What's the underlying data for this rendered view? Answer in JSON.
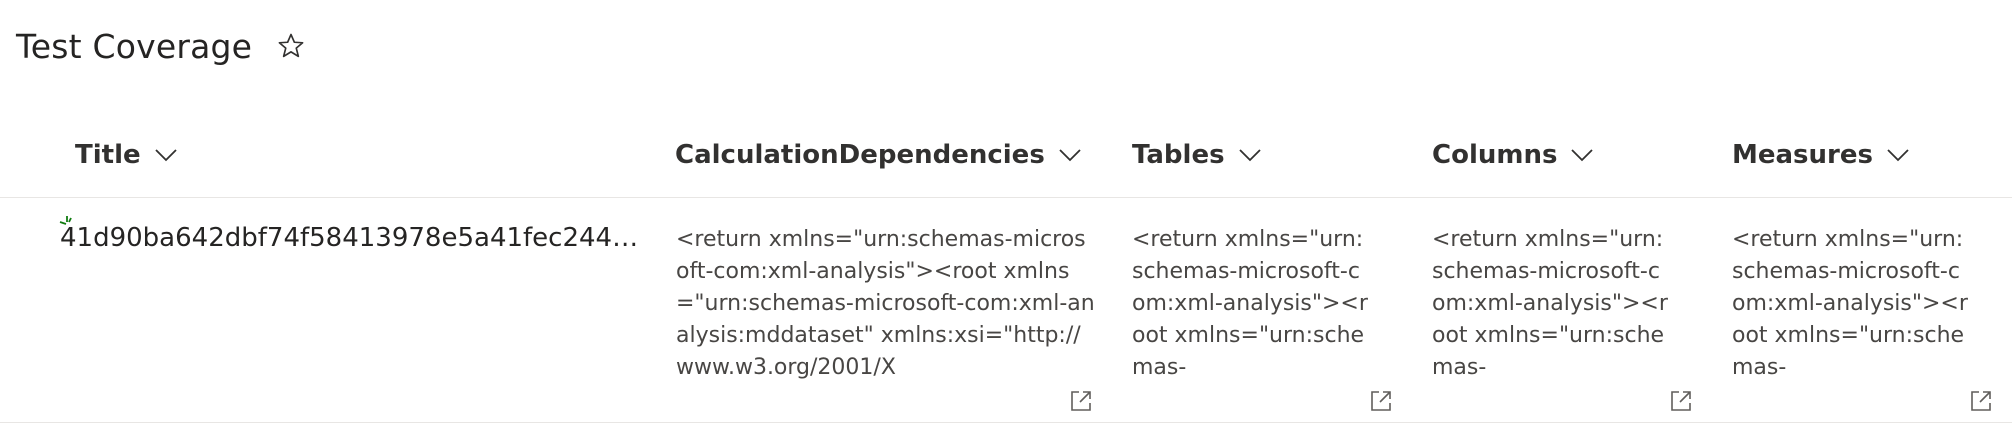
{
  "page": {
    "title": "Test Coverage"
  },
  "columns": [
    {
      "label": "Title"
    },
    {
      "label": "CalculationDependencies"
    },
    {
      "label": "Tables"
    },
    {
      "label": "Columns"
    },
    {
      "label": "Measures"
    }
  ],
  "row": {
    "title": "41d90ba642dbf74f58413978e5a41fec244ca…",
    "calculation_dependencies": "<return xmlns=\"urn:schemas-microsoft-com:xml-analysis\"><root xmlns=\"urn:schemas-microsoft-com:xml-analysis:mddataset\" xmlns:xsi=\"http://www.w3.org/2001/X",
    "tables": "<return xmlns=\"urn:schemas-microsoft-com:xml-analysis\"><root xmlns=\"urn:schemas-",
    "columns": "<return xmlns=\"urn:schemas-microsoft-com:xml-analysis\"><root xmlns=\"urn:schemas-",
    "measures": "<return xmlns=\"urn:schemas-microsoft-com:xml-analysis\"><root xmlns=\"urn:schemas-"
  },
  "icons": {
    "favorite": "star-outline-icon",
    "sort": "chevron-down-icon",
    "expand": "open-in-new-icon",
    "new_item": "new-item-sparkle-icon"
  },
  "colors": {
    "new_badge": "#107c10",
    "text": "#323130",
    "divider": "#e8e6e4"
  }
}
